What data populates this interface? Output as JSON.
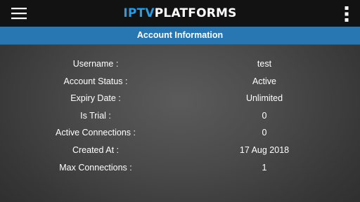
{
  "header": {
    "logo_part1": "IPTV",
    "logo_part2": "PLATFORMS",
    "menu_icon": "hamburger-menu-icon",
    "overflow_icon": "vertical-dots-icon"
  },
  "section": {
    "title": "Account Information"
  },
  "account": {
    "rows": [
      {
        "label": "Username :",
        "value": "test"
      },
      {
        "label": "Account Status :",
        "value": "Active"
      },
      {
        "label": "Expiry Date :",
        "value": "Unlimited"
      },
      {
        "label": "Is Trial :",
        "value": "0"
      },
      {
        "label": "Active Connections :",
        "value": "0"
      },
      {
        "label": "Created At :",
        "value": "17 Aug 2018"
      },
      {
        "label": "Max Connections :",
        "value": "1"
      }
    ]
  },
  "colors": {
    "topbar": "#121212",
    "accent": "#2a9be0",
    "section_bar": "#2877b3",
    "text": "#ffffff"
  }
}
